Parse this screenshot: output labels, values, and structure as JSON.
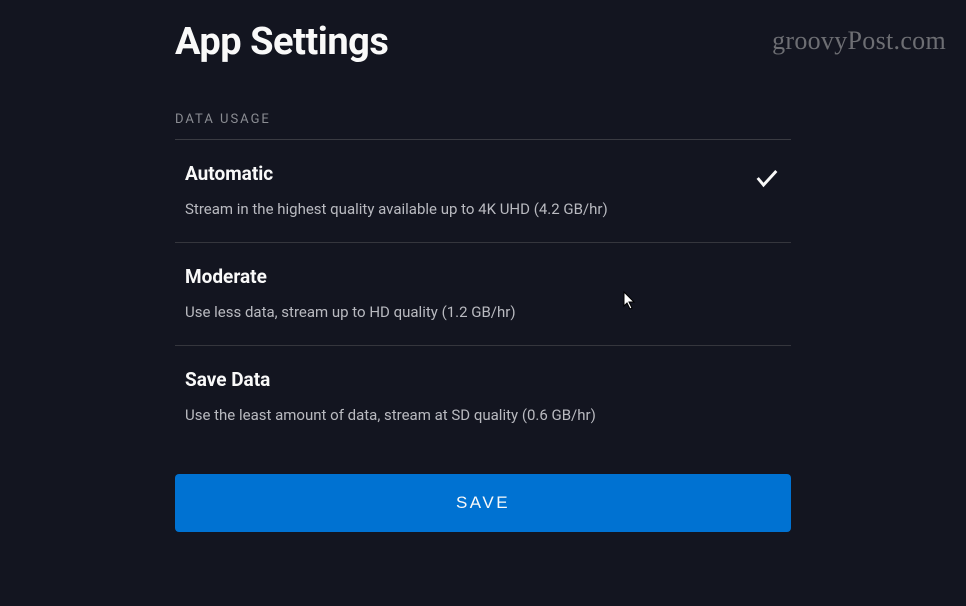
{
  "page": {
    "title": "App Settings"
  },
  "watermark": "groovyPost.com",
  "section": {
    "label": "DATA USAGE"
  },
  "options": [
    {
      "title": "Automatic",
      "description": "Stream in the highest quality available up to 4K UHD (4.2 GB/hr)",
      "selected": true
    },
    {
      "title": "Moderate",
      "description": "Use less data, stream up to HD quality (1.2 GB/hr)",
      "selected": false
    },
    {
      "title": "Save Data",
      "description": "Use the least amount of data, stream at SD quality (0.6 GB/hr)",
      "selected": false
    }
  ],
  "actions": {
    "save_label": "SAVE"
  }
}
